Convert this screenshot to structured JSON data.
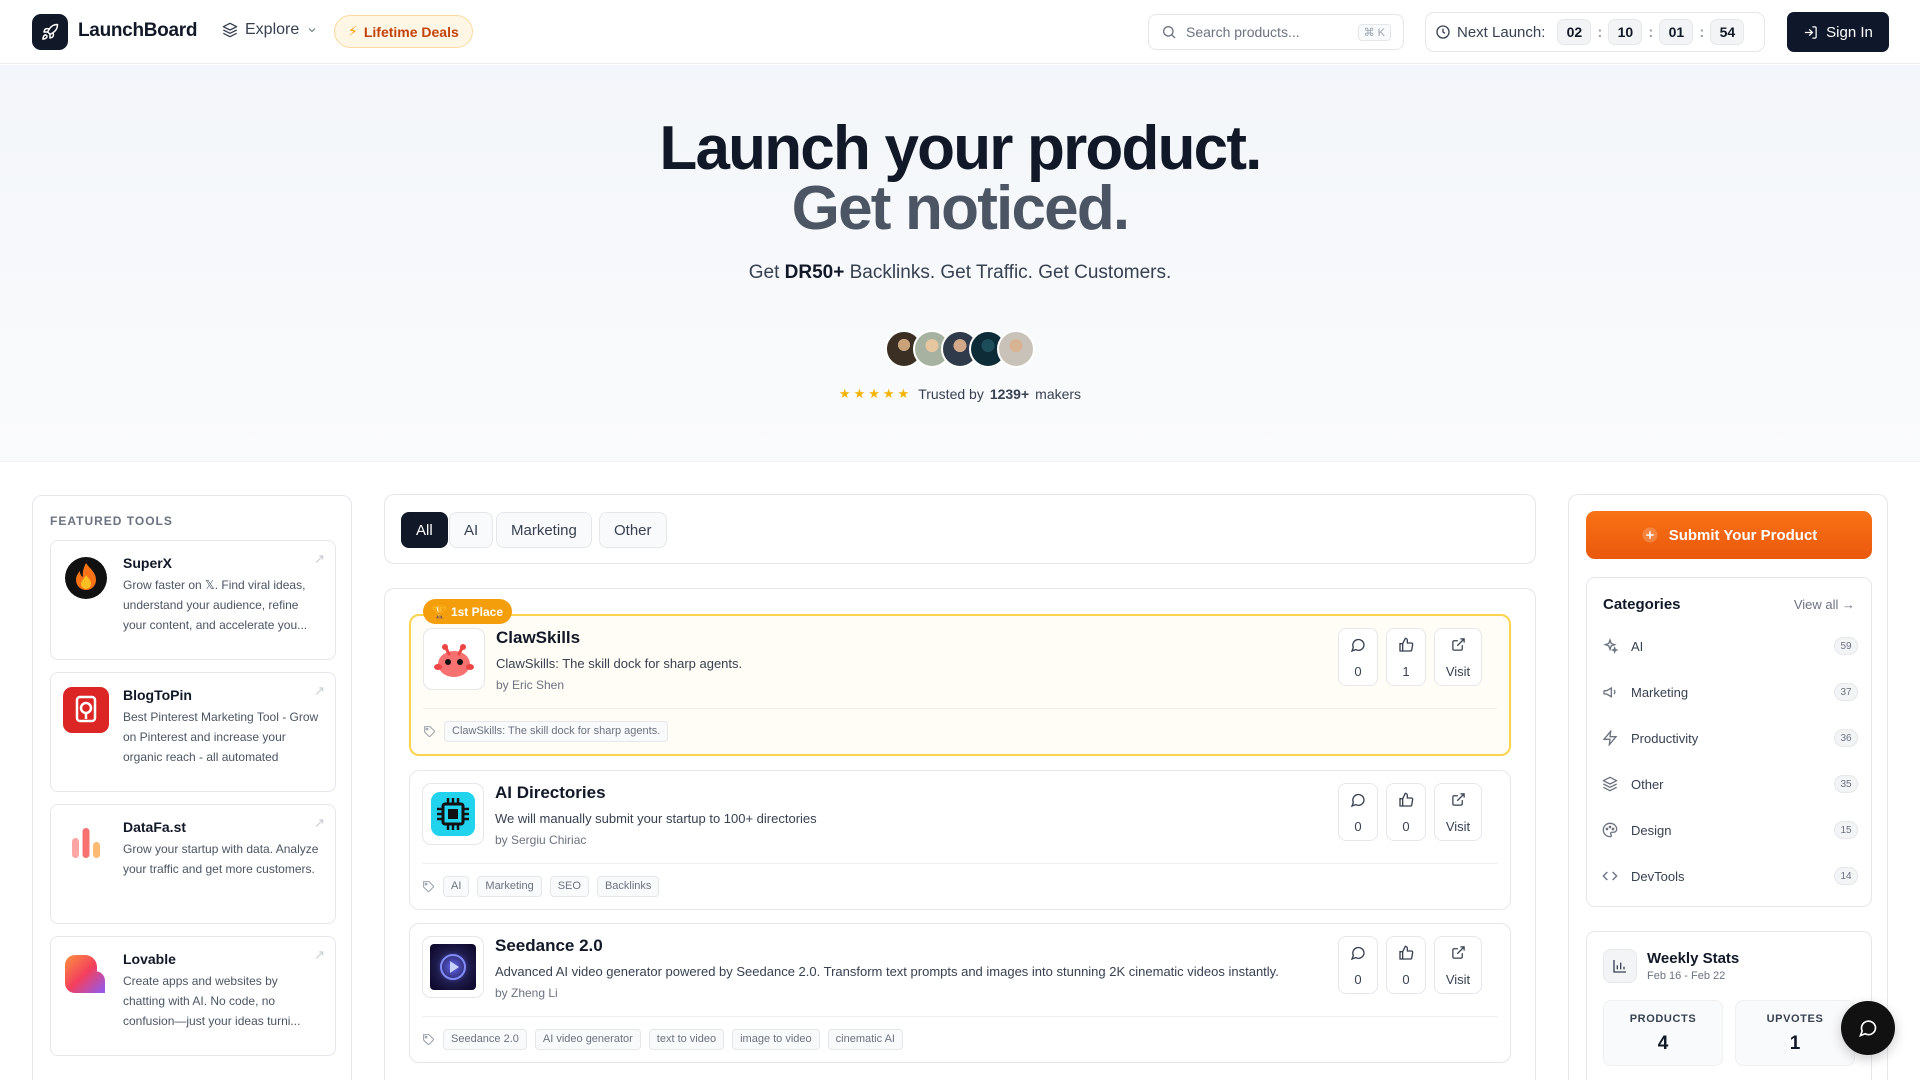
{
  "header": {
    "app_name": "LaunchBoard",
    "explore_label": "Explore",
    "deals_label": "Lifetime Deals",
    "search_placeholder": "Search products...",
    "search_shortcut": "⌘ K",
    "next_launch_label": "Next Launch:",
    "countdown": [
      "02",
      "10",
      "01",
      "54"
    ],
    "signin_label": "Sign In"
  },
  "hero": {
    "title_line1": "Launch your product.",
    "title_line2": "Get noticed.",
    "sub_prefix": "Get ",
    "sub_bold": "DR50+",
    "sub_suffix": " Backlinks. Get Traffic. Get Customers.",
    "stars": "★★★★★",
    "trust_prefix": "Trusted by",
    "trust_count": "1239+",
    "trust_suffix": "makers"
  },
  "featured": {
    "title": "FEATURED TOOLS",
    "tools": [
      {
        "name": "SuperX",
        "desc": "Grow faster on 𝕏. Find viral ideas, understand your audience, refine your content, and accelerate you...",
        "icon": "superx-icon"
      },
      {
        "name": "BlogToPin",
        "desc": "Best Pinterest Marketing Tool - Grow on Pinterest and increase your organic reach - all automated",
        "icon": "blogtopin-icon"
      },
      {
        "name": "DataFa.st",
        "desc": "Grow your startup with data. Analyze your traffic and get more customers.",
        "icon": "datafast-icon"
      },
      {
        "name": "Lovable",
        "desc": "Create apps and websites by chatting with AI. No code, no confusion—just your ideas turni...",
        "icon": "lovable-icon"
      }
    ]
  },
  "filters": [
    "All",
    "AI",
    "Marketing",
    "Other"
  ],
  "products": [
    {
      "badge": "1st Place",
      "name": "ClawSkills",
      "desc": "ClawSkills: The skill dock for sharp agents.",
      "by": "by Eric Shen",
      "comments": "0",
      "upvotes": "1",
      "visit": "Visit",
      "tags": [
        "ClawSkills: The skill dock for sharp agents."
      ]
    },
    {
      "name": "AI Directories",
      "desc": "We will manually submit your startup to 100+ directories",
      "by": "by Sergiu Chiriac",
      "comments": "0",
      "upvotes": "0",
      "visit": "Visit",
      "tags": [
        "AI",
        "Marketing",
        "SEO",
        "Backlinks"
      ]
    },
    {
      "name": "Seedance 2.0",
      "desc": "Advanced AI video generator powered by Seedance 2.0. Transform text prompts and images into stunning 2K cinematic videos instantly.",
      "by": "by Zheng Li",
      "comments": "0",
      "upvotes": "0",
      "visit": "Visit",
      "tags": [
        "Seedance 2.0",
        "AI video generator",
        "text to video",
        "image to video",
        "cinematic AI"
      ]
    }
  ],
  "sidebar": {
    "submit_label": "Submit Your Product",
    "categories_title": "Categories",
    "view_all": "View all →",
    "categories": [
      {
        "name": "AI",
        "count": "59",
        "icon": "sparkles-icon"
      },
      {
        "name": "Marketing",
        "count": "37",
        "icon": "megaphone-icon"
      },
      {
        "name": "Productivity",
        "count": "36",
        "icon": "bolt-icon"
      },
      {
        "name": "Other",
        "count": "35",
        "icon": "layers-icon"
      },
      {
        "name": "Design",
        "count": "15",
        "icon": "palette-icon"
      },
      {
        "name": "DevTools",
        "count": "14",
        "icon": "code-icon"
      }
    ],
    "stats_title": "Weekly Stats",
    "stats_range": "Feb 16 - Feb 22",
    "stat_products_label": "PRODUCTS",
    "stat_products_value": "4",
    "stat_upvotes_label": "UPVOTES",
    "stat_upvotes_value": "1"
  },
  "colors": {
    "accent_orange": "#ea580c",
    "gold": "#f59e0b",
    "dark": "#111827"
  }
}
